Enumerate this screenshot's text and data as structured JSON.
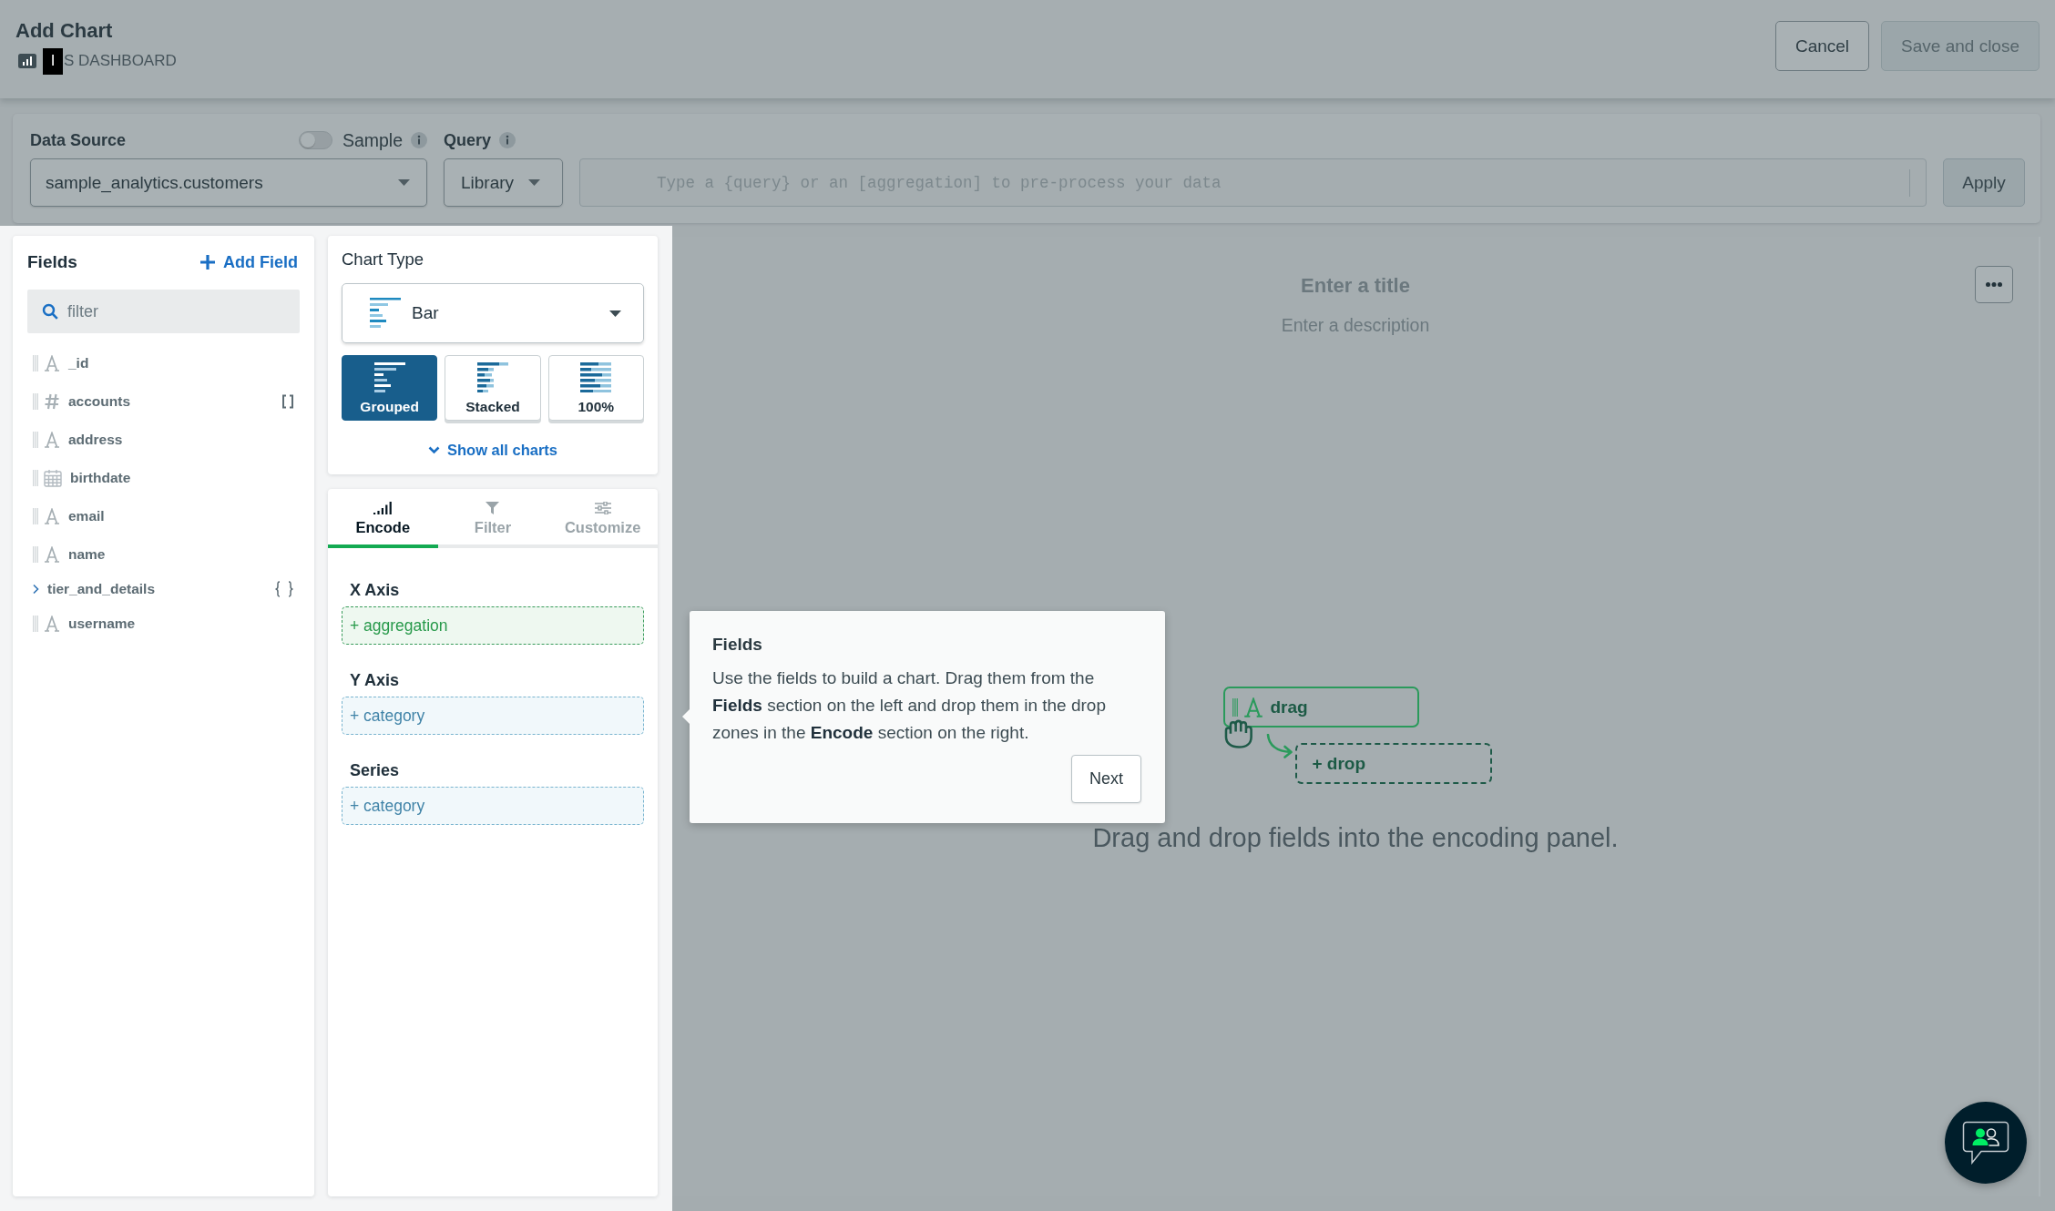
{
  "header": {
    "title": "Add Chart",
    "dashboard": {
      "redacted": "I",
      "name": "S DASHBOARD"
    },
    "buttons": [
      {
        "label": "Cancel",
        "disabled": false
      },
      {
        "label": "Save and close",
        "disabled": true
      }
    ]
  },
  "data_source": {
    "label": "Data Source",
    "value": "sample_analytics.customers",
    "sample": {
      "label": "Sample",
      "on": false
    },
    "query": {
      "label": "Query",
      "mode": "Library",
      "placeholder": "Type a {query} or an [aggregation] to pre-process your data",
      "apply": "Apply"
    }
  },
  "fields": {
    "title": "Fields",
    "add": "Add Field",
    "search": {
      "placeholder": "filter"
    },
    "items": [
      {
        "name": "_id",
        "kind": "string",
        "array": false
      },
      {
        "name": "accounts",
        "kind": "number",
        "array": true
      },
      {
        "name": "address",
        "kind": "string",
        "array": false
      },
      {
        "name": "birthdate",
        "kind": "date",
        "array": false
      },
      {
        "name": "email",
        "kind": "string",
        "array": false
      },
      {
        "name": "name",
        "kind": "string",
        "array": false
      },
      {
        "name": "tier_and_details",
        "kind": "object",
        "array": false
      },
      {
        "name": "username",
        "kind": "string",
        "array": false
      }
    ]
  },
  "chart_type": {
    "title": "Chart Type",
    "value": "Bar",
    "variants": [
      {
        "label": "Grouped",
        "kind": "grouped",
        "selected": true
      },
      {
        "label": "Stacked",
        "kind": "stacked",
        "selected": false
      },
      {
        "label": "100%",
        "kind": "percent",
        "selected": false
      }
    ],
    "show_all": "Show all charts"
  },
  "encode": {
    "tabs": [
      {
        "label": "Encode",
        "kind": "encode",
        "selected": true
      },
      {
        "label": "Filter",
        "kind": "filter",
        "selected": false
      },
      {
        "label": "Customize",
        "kind": "customize",
        "selected": false
      }
    ],
    "channels": [
      {
        "label": "X Axis",
        "placeholder": "+ aggregation",
        "kind": "aggregation"
      },
      {
        "label": "Y Axis",
        "placeholder": "+ category",
        "kind": "category"
      },
      {
        "label": "Series",
        "placeholder": "+ category",
        "kind": "category"
      }
    ]
  },
  "chart": {
    "title": {
      "placeholder": "Enter a title"
    },
    "description": {
      "placeholder": "Enter a description"
    },
    "illustration": {
      "drag": "drag",
      "drop": "+ drop"
    },
    "message": "Drag and drop fields into the encoding panel."
  },
  "tooltip": {
    "title": "Fields",
    "text": "Use the fields to build a chart. Drag them from the **Fields** section on the left and drop them in the drop zones in the **Encode** section on the right.",
    "button": "Next"
  }
}
